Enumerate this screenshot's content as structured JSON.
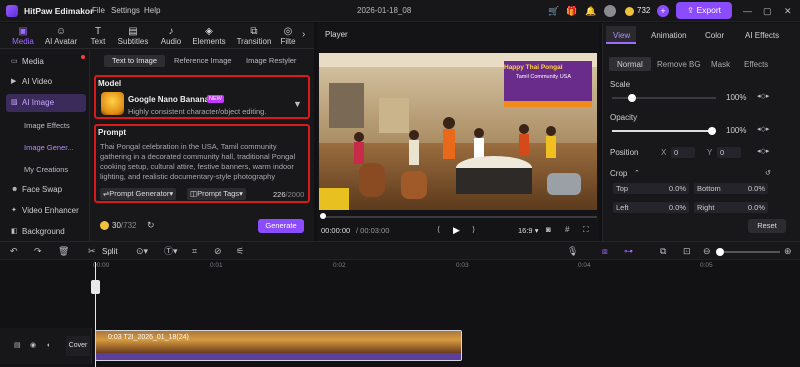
{
  "titlebar": {
    "app_name": "HitPaw Edimakor",
    "menus": [
      "File",
      "Settings",
      "Help"
    ],
    "project": "2026-01-18_08",
    "credits": "732",
    "export_label": "Export"
  },
  "toolbar_tabs": [
    {
      "label": "Media",
      "icon": "media-icon"
    },
    {
      "label": "AI Avatar",
      "icon": "avatar-icon"
    },
    {
      "label": "Text",
      "icon": "text-icon"
    },
    {
      "label": "Subtitles",
      "icon": "subtitles-icon"
    },
    {
      "label": "Audio",
      "icon": "audio-icon"
    },
    {
      "label": "Elements",
      "icon": "elements-icon"
    },
    {
      "label": "Transition",
      "icon": "transition-icon"
    },
    {
      "label": "Filte",
      "icon": "filter-icon"
    }
  ],
  "sidebar": {
    "items": [
      "Media",
      "AI Video",
      "AI Image",
      "Face Swap",
      "Video Enhancer",
      "Background"
    ],
    "sub_items": [
      "Image Effects",
      "Image Gener...",
      "My Creations"
    ]
  },
  "ai_image": {
    "subtabs": [
      "Text to Image",
      "Reference Image",
      "Image Restyler"
    ],
    "model_label": "Model",
    "model_name": "Google Nano Banana",
    "model_badge": "NEW",
    "model_desc": "Highly consistent character/object editing.",
    "prompt_label": "Prompt",
    "prompt_text": "Thai Pongal celebration in the USA, Tamil community gathering in a decorated community hall, traditional Pongal cooking setup, cultural attire, festive banners, warm indoor lighting, and realistic documentary-style photography",
    "prompt_generator": "Prompt Generator",
    "prompt_tags": "Prompt Tags",
    "char_count": "226",
    "char_max": "/2000",
    "cost": "30",
    "cost_total": "/732",
    "generate_label": "Generate"
  },
  "player": {
    "title": "Player",
    "time_current": "00:00:00",
    "time_total": "/ 00:03:00",
    "ratio": "16:9",
    "banner_line1": "Happy Thai Pongal",
    "banner_line2": "Tamil Community USA"
  },
  "right_panel": {
    "tabs": [
      "View",
      "Animation",
      "Color",
      "AI Effects"
    ],
    "subtabs": [
      "Normal",
      "Remove BG",
      "Mask",
      "Effects"
    ],
    "scale_label": "Scale",
    "scale_value": "100%",
    "opacity_label": "Opacity",
    "opacity_value": "100%",
    "position_label": "Position",
    "pos_x_label": "X",
    "pos_x": "0",
    "pos_y_label": "Y",
    "pos_y": "0",
    "crop_label": "Crop",
    "crop": [
      {
        "label": "Top",
        "value": "0.0%"
      },
      {
        "label": "Bottom",
        "value": "0.0%"
      },
      {
        "label": "Left",
        "value": "0.0%"
      },
      {
        "label": "Right",
        "value": "0.0%"
      }
    ],
    "reset_label": "Reset"
  },
  "timeline": {
    "split_label": "Split",
    "ticks": [
      "00:00",
      "0:01",
      "0:02",
      "0:03",
      "0:04",
      "0:05"
    ],
    "cover_label": "Cover",
    "clip_label": "0:03  T2I_2026_01_18(24)"
  }
}
